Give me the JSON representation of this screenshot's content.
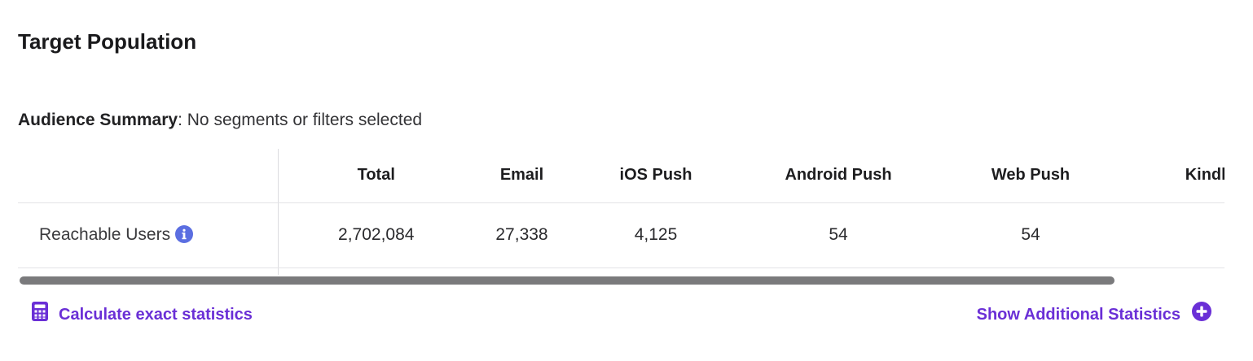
{
  "section": {
    "title": "Target Population"
  },
  "summary": {
    "label": "Audience Summary",
    "separator": ":",
    "text": "No segments or filters selected"
  },
  "table": {
    "columns": [
      "Total",
      "Email",
      "iOS Push",
      "Android Push",
      "Web Push",
      "Kindle Push"
    ],
    "rows": [
      {
        "label": "Reachable Users",
        "info_icon": "info-icon",
        "values": [
          "2,702,084",
          "27,338",
          "4,125",
          "54",
          "54"
        ]
      }
    ]
  },
  "actions": {
    "calculate_label": "Calculate exact statistics",
    "calculate_icon": "calculator-icon",
    "additional_label": "Show Additional Statistics",
    "additional_icon": "plus-circle-icon"
  },
  "colors": {
    "accent": "#6a2fd6",
    "info_blue": "#5b6ee1",
    "scrollbar": "#7a7a7c"
  }
}
